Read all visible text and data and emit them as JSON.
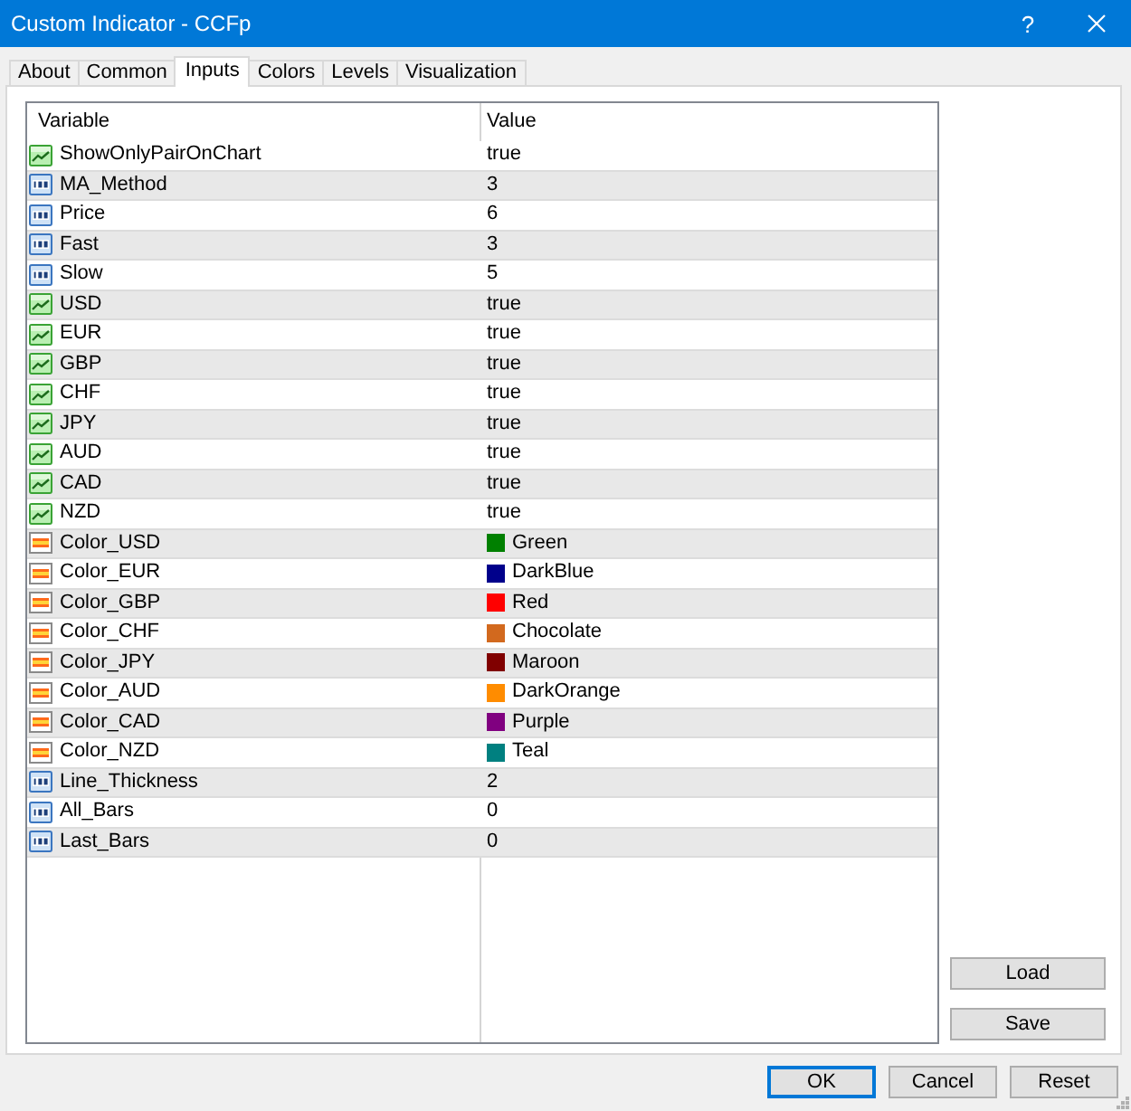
{
  "window": {
    "title": "Custom Indicator - CCFp",
    "help": "?"
  },
  "tabs": [
    {
      "label": "About",
      "selected": false
    },
    {
      "label": "Common",
      "selected": false
    },
    {
      "label": "Inputs",
      "selected": true
    },
    {
      "label": "Colors",
      "selected": false
    },
    {
      "label": "Levels",
      "selected": false
    },
    {
      "label": "Visualization",
      "selected": false
    }
  ],
  "inputs": {
    "columns": [
      "Variable",
      "Value"
    ],
    "rows": [
      {
        "kind": "bool",
        "name": "ShowOnlyPairOnChart",
        "value": "true"
      },
      {
        "kind": "int",
        "name": "MA_Method",
        "value": "3"
      },
      {
        "kind": "int",
        "name": "Price",
        "value": "6"
      },
      {
        "kind": "int",
        "name": "Fast",
        "value": "3"
      },
      {
        "kind": "int",
        "name": "Slow",
        "value": "5"
      },
      {
        "kind": "bool",
        "name": "USD",
        "value": "true"
      },
      {
        "kind": "bool",
        "name": "EUR",
        "value": "true"
      },
      {
        "kind": "bool",
        "name": "GBP",
        "value": "true"
      },
      {
        "kind": "bool",
        "name": "CHF",
        "value": "true"
      },
      {
        "kind": "bool",
        "name": "JPY",
        "value": "true"
      },
      {
        "kind": "bool",
        "name": "AUD",
        "value": "true"
      },
      {
        "kind": "bool",
        "name": "CAD",
        "value": "true"
      },
      {
        "kind": "bool",
        "name": "NZD",
        "value": "true"
      },
      {
        "kind": "color",
        "name": "Color_USD",
        "value": "Green",
        "color": "#008000"
      },
      {
        "kind": "color",
        "name": "Color_EUR",
        "value": "DarkBlue",
        "color": "#00008b"
      },
      {
        "kind": "color",
        "name": "Color_GBP",
        "value": "Red",
        "color": "#ff0000"
      },
      {
        "kind": "color",
        "name": "Color_CHF",
        "value": "Chocolate",
        "color": "#d2691e"
      },
      {
        "kind": "color",
        "name": "Color_JPY",
        "value": "Maroon",
        "color": "#800000"
      },
      {
        "kind": "color",
        "name": "Color_AUD",
        "value": "DarkOrange",
        "color": "#ff8c00"
      },
      {
        "kind": "color",
        "name": "Color_CAD",
        "value": "Purple",
        "color": "#800080"
      },
      {
        "kind": "color",
        "name": "Color_NZD",
        "value": "Teal",
        "color": "#008080"
      },
      {
        "kind": "int",
        "name": "Line_Thickness",
        "value": "2"
      },
      {
        "kind": "int",
        "name": "All_Bars",
        "value": "0"
      },
      {
        "kind": "int",
        "name": "Last_Bars",
        "value": "0"
      }
    ]
  },
  "side_buttons": [
    "Load",
    "Save"
  ],
  "buttons": [
    {
      "label": "OK",
      "default": true
    },
    {
      "label": "Cancel",
      "default": false
    },
    {
      "label": "Reset",
      "default": false
    }
  ]
}
